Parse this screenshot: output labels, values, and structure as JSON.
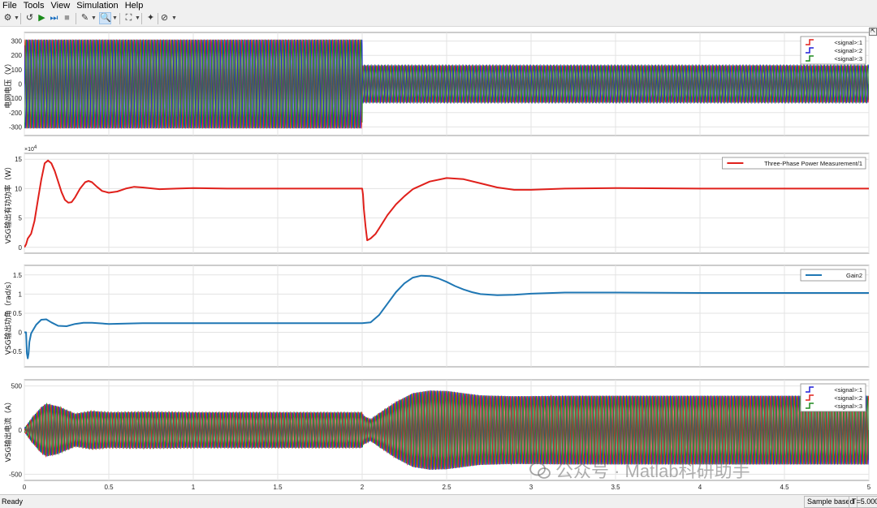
{
  "menu": [
    "File",
    "Tools",
    "View",
    "Simulation",
    "Help"
  ],
  "status": {
    "ready": "Ready",
    "sample": "Sample based",
    "time": "T=5.000"
  },
  "watermark": "公众号 · Matlab科研助手",
  "colors": {
    "red": "#e0201b",
    "blue": "#1f1fd8",
    "green": "#1f8a1f",
    "cyan": "#1f77b4"
  },
  "chart_data": [
    {
      "type": "line",
      "ylabel": "电网电压（V）",
      "xlim": [
        0,
        5
      ],
      "ylim": [
        -360,
        360
      ],
      "yticks": [
        -300,
        -200,
        -100,
        0,
        100,
        200,
        300
      ],
      "grid": true,
      "legend": "top-right",
      "series": [
        {
          "name": "<signal>:1",
          "color": "#e0201b",
          "amplitude": [
            [
              0,
              311
            ],
            [
              2,
              311
            ],
            [
              2,
              130
            ],
            [
              5,
              130
            ]
          ]
        },
        {
          "name": "<signal>:2",
          "color": "#1f1fd8",
          "amplitude": [
            [
              0,
              311
            ],
            [
              2,
              311
            ],
            [
              2,
              130
            ],
            [
              5,
              130
            ]
          ]
        },
        {
          "name": "<signal>:3",
          "color": "#1f8a1f",
          "amplitude": [
            [
              0,
              311
            ],
            [
              2,
              311
            ],
            [
              2,
              130
            ],
            [
              5,
              130
            ]
          ]
        }
      ]
    },
    {
      "type": "line",
      "ylabel": "VSG输出有功功率（W）",
      "yexp": "×10",
      "yexp_power": "4",
      "xlim": [
        0,
        5
      ],
      "ylim": [
        -1,
        16
      ],
      "yticks": [
        0,
        5,
        10,
        15
      ],
      "grid": true,
      "legend": "top-right",
      "series": [
        {
          "name": "Three-Phase Power Measurement/1",
          "color": "#e0201b",
          "x": [
            0,
            0.01,
            0.02,
            0.04,
            0.06,
            0.08,
            0.1,
            0.12,
            0.14,
            0.16,
            0.18,
            0.2,
            0.22,
            0.24,
            0.26,
            0.28,
            0.3,
            0.33,
            0.36,
            0.38,
            0.4,
            0.43,
            0.46,
            0.5,
            0.55,
            0.6,
            0.65,
            0.7,
            0.8,
            0.9,
            1.0,
            1.2,
            1.5,
            2.0,
            2.005,
            2.01,
            2.02,
            2.03,
            2.05,
            2.08,
            2.1,
            2.15,
            2.2,
            2.25,
            2.3,
            2.4,
            2.5,
            2.6,
            2.7,
            2.8,
            2.9,
            3.0,
            3.2,
            3.5,
            4.0,
            4.5,
            5.0
          ],
          "values": [
            0,
            0.5,
            1.5,
            2.3,
            4.5,
            8,
            11.5,
            14.3,
            14.8,
            14.3,
            13,
            11.2,
            9.4,
            8.1,
            7.6,
            7.7,
            8.5,
            10,
            11.1,
            11.3,
            11.1,
            10.3,
            9.6,
            9.3,
            9.5,
            10,
            10.3,
            10.2,
            9.9,
            10,
            10.1,
            10,
            10,
            10,
            9,
            6.5,
            3.5,
            1.2,
            1.5,
            2.3,
            3.2,
            5.5,
            7.3,
            8.7,
            9.9,
            11.2,
            11.8,
            11.6,
            10.9,
            10.2,
            9.8,
            9.8,
            10,
            10.1,
            10,
            10,
            10
          ]
        }
      ]
    },
    {
      "type": "line",
      "ylabel": "VSG输出功角（rad/s）",
      "xlim": [
        0,
        5
      ],
      "ylim": [
        -0.9,
        1.75
      ],
      "yticks": [
        -0.5,
        0,
        0.5,
        1,
        1.5
      ],
      "grid": true,
      "legend": "top-right",
      "series": [
        {
          "name": "Gain2",
          "color": "#1f77b4",
          "x": [
            0,
            0.01,
            0.015,
            0.02,
            0.025,
            0.03,
            0.04,
            0.05,
            0.07,
            0.1,
            0.13,
            0.16,
            0.2,
            0.25,
            0.3,
            0.35,
            0.4,
            0.5,
            0.6,
            0.7,
            0.8,
            1.0,
            1.5,
            2.0,
            2.05,
            2.1,
            2.15,
            2.2,
            2.25,
            2.3,
            2.35,
            2.4,
            2.45,
            2.5,
            2.55,
            2.6,
            2.65,
            2.7,
            2.8,
            2.9,
            3.0,
            3.2,
            3.5,
            4.0,
            4.5,
            5.0
          ],
          "values": [
            0,
            0,
            -0.55,
            -0.68,
            -0.55,
            -0.25,
            -0.03,
            0.05,
            0.2,
            0.33,
            0.34,
            0.26,
            0.17,
            0.16,
            0.22,
            0.25,
            0.25,
            0.22,
            0.23,
            0.24,
            0.24,
            0.24,
            0.24,
            0.24,
            0.26,
            0.45,
            0.75,
            1.05,
            1.28,
            1.43,
            1.48,
            1.47,
            1.41,
            1.32,
            1.21,
            1.12,
            1.05,
            1.0,
            0.97,
            0.98,
            1.01,
            1.04,
            1.04,
            1.03,
            1.03,
            1.03
          ]
        }
      ]
    },
    {
      "type": "line",
      "ylabel": "VSG输出电流（A）",
      "xlim": [
        0,
        5
      ],
      "ylim": [
        -570,
        570
      ],
      "yticks": [
        -500,
        0,
        500
      ],
      "xticks": [
        0,
        0.5,
        1,
        1.5,
        2,
        2.5,
        3,
        3.5,
        4,
        4.5,
        5
      ],
      "grid": true,
      "legend": "top-right",
      "series": [
        {
          "name": "<signal>:1",
          "color": "#1f1fd8",
          "amplitude": [
            [
              0,
              20
            ],
            [
              0.05,
              150
            ],
            [
              0.1,
              260
            ],
            [
              0.13,
              300
            ],
            [
              0.2,
              270
            ],
            [
              0.3,
              185
            ],
            [
              0.4,
              215
            ],
            [
              0.5,
              200
            ],
            [
              0.7,
              205
            ],
            [
              1.0,
              200
            ],
            [
              2.0,
              200
            ],
            [
              2.01,
              160
            ],
            [
              2.05,
              120
            ],
            [
              2.1,
              190
            ],
            [
              2.2,
              320
            ],
            [
              2.3,
              420
            ],
            [
              2.4,
              450
            ],
            [
              2.5,
              445
            ],
            [
              2.6,
              420
            ],
            [
              2.7,
              395
            ],
            [
              2.9,
              385
            ],
            [
              3.2,
              390
            ],
            [
              5.0,
              390
            ]
          ]
        },
        {
          "name": "<signal>:2",
          "color": "#e0201b",
          "amplitude": [
            [
              0,
              20
            ],
            [
              0.05,
              150
            ],
            [
              0.1,
              260
            ],
            [
              0.13,
              300
            ],
            [
              0.2,
              270
            ],
            [
              0.3,
              185
            ],
            [
              0.4,
              215
            ],
            [
              0.5,
              200
            ],
            [
              0.7,
              205
            ],
            [
              1.0,
              200
            ],
            [
              2.0,
              200
            ],
            [
              2.01,
              160
            ],
            [
              2.05,
              120
            ],
            [
              2.1,
              190
            ],
            [
              2.2,
              320
            ],
            [
              2.3,
              420
            ],
            [
              2.4,
              450
            ],
            [
              2.5,
              445
            ],
            [
              2.6,
              420
            ],
            [
              2.7,
              395
            ],
            [
              2.9,
              385
            ],
            [
              3.2,
              390
            ],
            [
              5.0,
              390
            ]
          ]
        },
        {
          "name": "<signal>:3",
          "color": "#1f8a1f",
          "amplitude": [
            [
              0,
              20
            ],
            [
              0.05,
              150
            ],
            [
              0.1,
              260
            ],
            [
              0.13,
              300
            ],
            [
              0.2,
              270
            ],
            [
              0.3,
              185
            ],
            [
              0.4,
              215
            ],
            [
              0.5,
              200
            ],
            [
              0.7,
              205
            ],
            [
              1.0,
              200
            ],
            [
              2.0,
              200
            ],
            [
              2.01,
              160
            ],
            [
              2.05,
              120
            ],
            [
              2.1,
              190
            ],
            [
              2.2,
              320
            ],
            [
              2.3,
              420
            ],
            [
              2.4,
              450
            ],
            [
              2.5,
              445
            ],
            [
              2.6,
              420
            ],
            [
              2.7,
              395
            ],
            [
              2.9,
              385
            ],
            [
              3.2,
              390
            ],
            [
              5.0,
              390
            ]
          ]
        }
      ]
    }
  ]
}
